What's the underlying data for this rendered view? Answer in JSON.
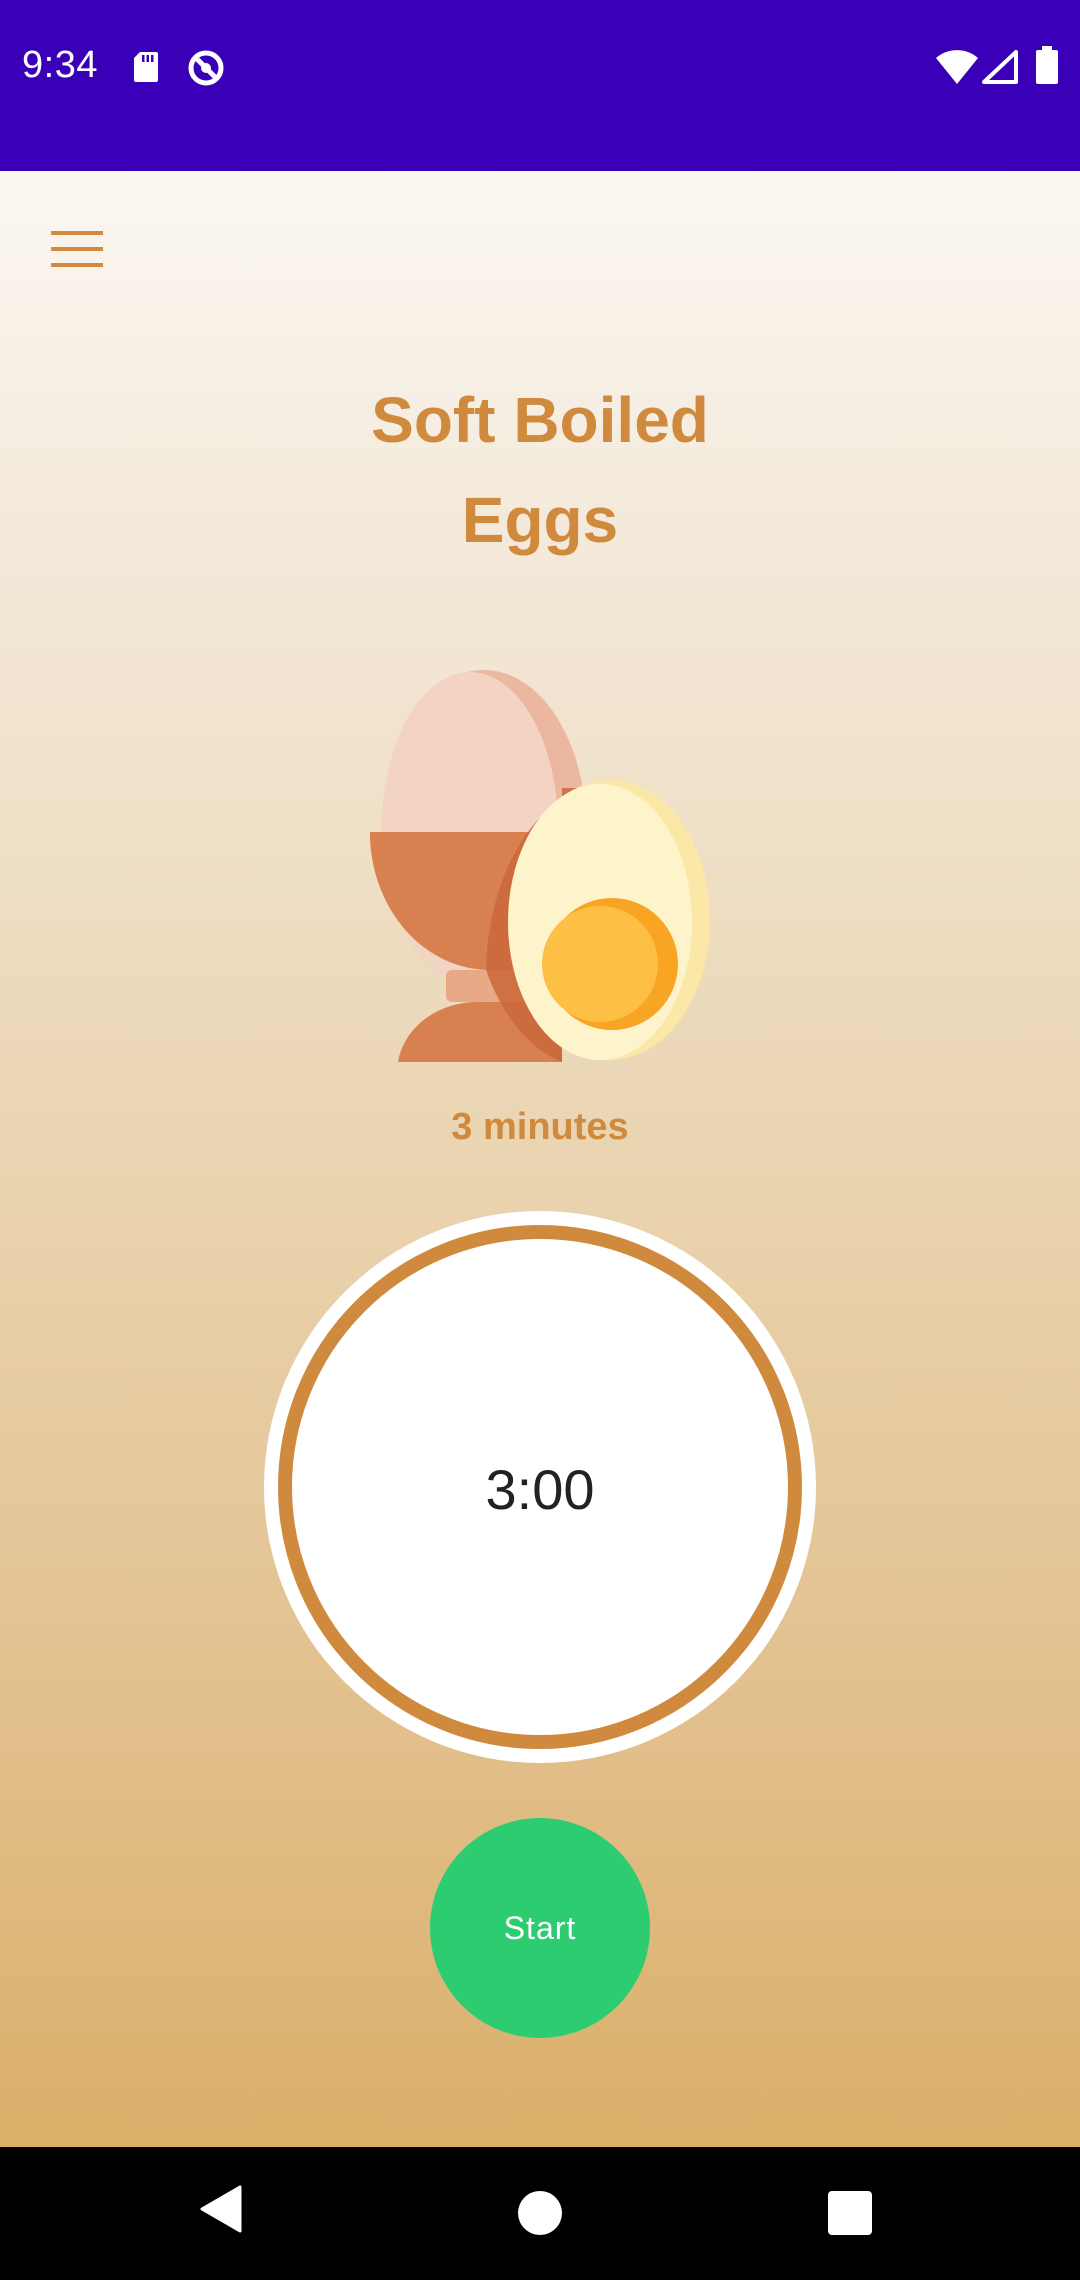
{
  "status_bar": {
    "time": "9:34",
    "background_color": "#3a00b8",
    "icons": [
      "sd-card-icon",
      "sync-disabled-icon",
      "wifi-icon",
      "cell-signal-icon",
      "battery-icon"
    ]
  },
  "toolbar": {
    "menu_icon": "hamburger-menu-icon"
  },
  "egg": {
    "title_line1": "Soft Boiled",
    "title_line2": "Eggs",
    "duration": "3 minutes",
    "illustration": "boiled-egg-in-cup-icon"
  },
  "timer": {
    "display": "3:00",
    "progress_fraction": 1.0,
    "ring_color": "#d08a3e"
  },
  "actions": {
    "start_label": "Start",
    "start_color": "#2ecc71"
  },
  "nav_bar": {
    "icons": [
      "back-icon",
      "home-icon",
      "recents-icon"
    ]
  },
  "theme": {
    "accent": "#d08a3e",
    "text_dark": "#222222"
  }
}
